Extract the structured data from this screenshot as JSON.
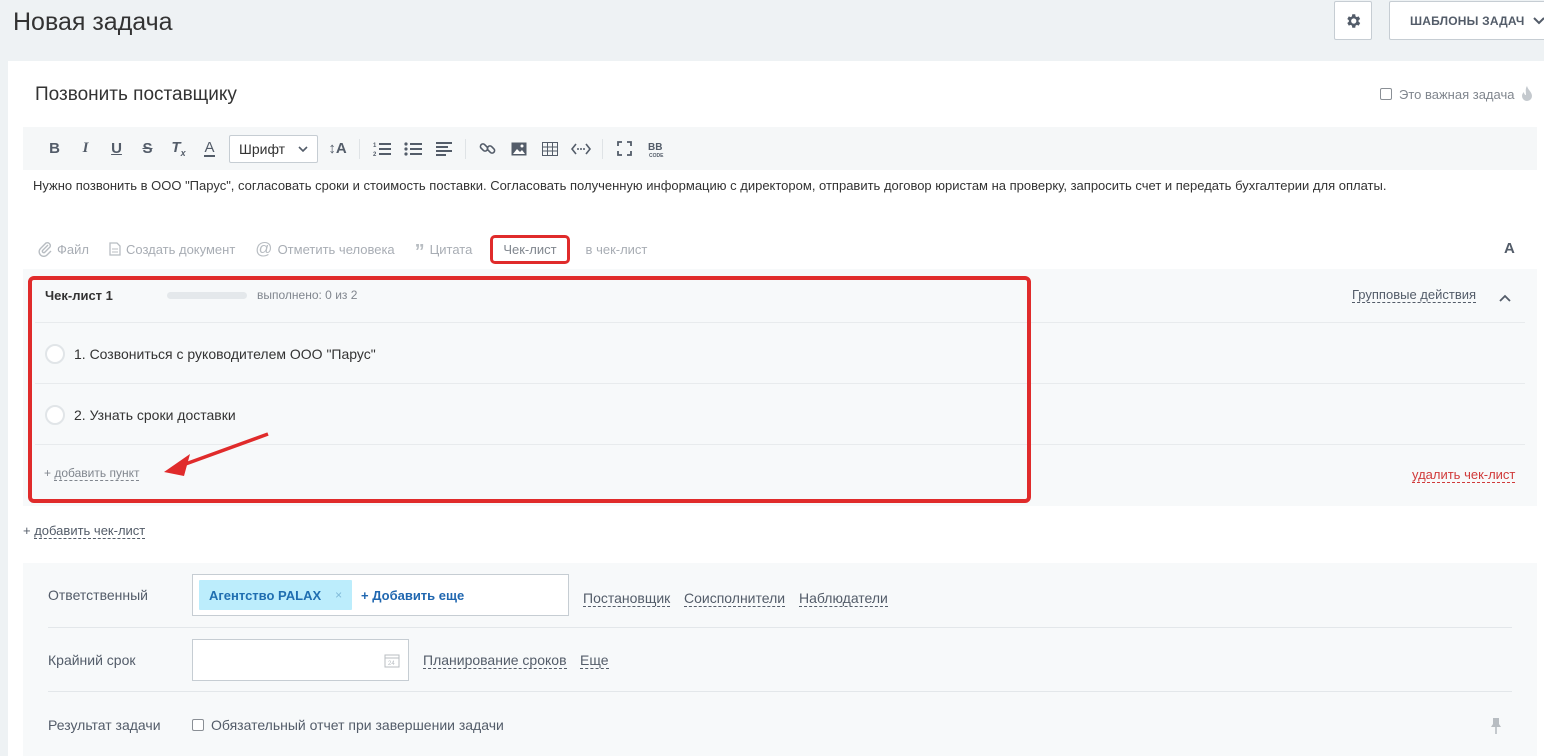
{
  "header": {
    "title": "Новая задача",
    "templates_label": "ШАБЛОНЫ ЗАДАЧ"
  },
  "task": {
    "title": "Позвонить поставщику",
    "important_label": "Это важная задача",
    "font_select": "Шрифт",
    "description": "Нужно позвонить в ООО \"Парус\", согласовать сроки и стоимость поставки. Согласовать полученную информацию с директором, отправить договор юристам на проверку, запросить счет и передать бухгалтерии для оплаты."
  },
  "attach_bar": {
    "file": "Файл",
    "create_doc": "Создать документ",
    "mention": "Отметить человека",
    "quote": "Цитата",
    "checklist": "Чек-лист",
    "to_checklist": "в чек-лист",
    "font_toggle": "A"
  },
  "checklist": {
    "title": "Чек-лист 1",
    "progress_fraction": 0,
    "done_text": "выполнено: 0 из 2",
    "group_actions": "Групповые действия",
    "items": [
      {
        "text": "1. Созвониться с руководителем ООО \"Парус\""
      },
      {
        "text": "2. Узнать сроки доставки"
      }
    ],
    "add_item": "добавить пункт",
    "add_prefix": "+",
    "delete": "удалить чек-лист"
  },
  "add_checklist": "добавить чек-лист",
  "fields": {
    "responsible_label": "Ответственный",
    "responsible_chip": "Агентство PALAX",
    "chip_remove": "×",
    "add_more": "+ Добавить еще",
    "creator": "Постановщик",
    "coexecutors": "Соисполнители",
    "observers": "Наблюдатели",
    "deadline_label": "Крайний срок",
    "planning": "Планирование сроков",
    "more": "Еще",
    "result_label": "Результат задачи",
    "report_label": "Обязательный отчет при завершении задачи"
  },
  "colors": {
    "highlight": "#e02b2b",
    "chip_bg": "#bcedfc",
    "link_blue": "#2067b0",
    "delete_red": "#d03a3a"
  }
}
